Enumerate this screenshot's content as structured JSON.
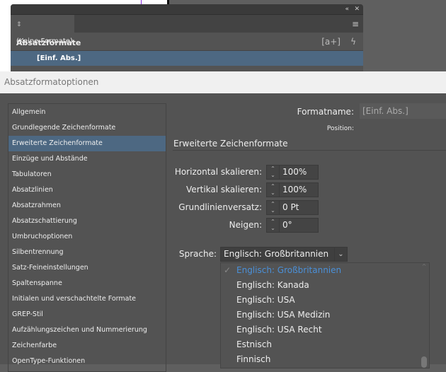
{
  "panel": {
    "title": "Absatzformate",
    "collapse_icon": "double-chevron",
    "close_icon": "close",
    "menu_icon": "hamburger",
    "rows": [
      "(Keine Formate)",
      "[Einf. Abs.]"
    ],
    "new_style_icon": "[a+]",
    "quick_apply_icon": "lightning"
  },
  "dialog": {
    "title": "Absatzformatoptionen",
    "sidebar": [
      "Allgemein",
      "Grundlegende Zeichenformate",
      "Erweiterte Zeichenformate",
      "Einzüge und Abstände",
      "Tabulatoren",
      "Absatzlinien",
      "Absatzrahmen",
      "Absatzschattierung",
      "Umbruchoptionen",
      "Silbentrennung",
      "Satz-Feineinstellungen",
      "Spaltenspanne",
      "Initialen und verschachtelte Formate",
      "GREP-Stil",
      "Aufzählungszeichen und Nummerierung",
      "Zeichenfarbe",
      "OpenType-Funktionen"
    ],
    "selected_index": 2,
    "formatname_label": "Formatname:",
    "formatname_value": "[Einf. Abs.]",
    "position_label": "Position:",
    "section_title": "Erweiterte Zeichenformate",
    "fields": [
      {
        "label": "Horizontal skalieren:",
        "value": "100%"
      },
      {
        "label": "Vertikal skalieren:",
        "value": "100%"
      },
      {
        "label": "Grundlinienversatz:",
        "value": "0 Pt"
      },
      {
        "label": "Neigen:",
        "value": "0°"
      }
    ],
    "language_label": "Sprache:",
    "language_value": "Englisch: Großbritannien",
    "language_options": [
      "Englisch: Großbritannien",
      "Englisch: Kanada",
      "Englisch: USA",
      "Englisch: USA Medizin",
      "Englisch: USA Recht",
      "Estnisch",
      "Finnisch"
    ],
    "accent": "#4a90d9",
    "selection_color": "#4d6882"
  }
}
